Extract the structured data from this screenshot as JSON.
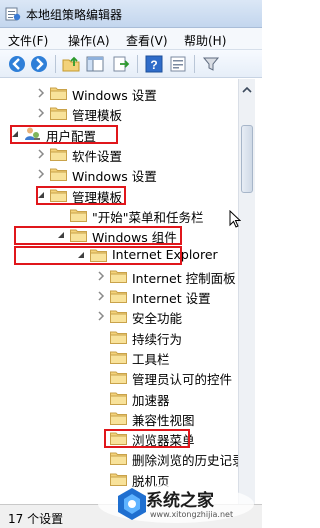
{
  "window": {
    "title": "本地组策略编辑器"
  },
  "menu": [
    "文件(F)",
    "操作(A)",
    "查看(V)",
    "帮助(H)"
  ],
  "toolbar": {
    "buttons": [
      "back-icon",
      "forward-icon",
      "up-folder-icon",
      "show-hide-tree-icon",
      "export-list-icon",
      "help-icon",
      "properties-icon",
      "filter-icon"
    ]
  },
  "tree": {
    "rows": [
      {
        "label": "Windows 设置",
        "expander": "collapsed",
        "icon": "folder-icon"
      },
      {
        "label": "管理模板",
        "expander": "collapsed",
        "icon": "folder-icon"
      },
      {
        "label": "用户配置",
        "expander": "expanded",
        "icon": "user-config-icon",
        "highlighted": true
      },
      {
        "label": "软件设置",
        "expander": "collapsed",
        "icon": "folder-icon"
      },
      {
        "label": "Windows 设置",
        "expander": "collapsed",
        "icon": "folder-icon"
      },
      {
        "label": "管理模板",
        "expander": "expanded",
        "icon": "folder-icon",
        "highlighted": true
      },
      {
        "label": "\"开始\"菜单和任务栏",
        "expander": "none",
        "icon": "folder-icon"
      },
      {
        "label": "Windows 组件",
        "expander": "expanded",
        "icon": "folder-icon",
        "highlighted": true
      },
      {
        "label": "Internet Explorer",
        "expander": "expanded",
        "icon": "folder-icon",
        "highlighted": true
      },
      {
        "label": "Internet 控制面板",
        "expander": "collapsed",
        "icon": "folder-icon"
      },
      {
        "label": "Internet 设置",
        "expander": "collapsed",
        "icon": "folder-icon"
      },
      {
        "label": "安全功能",
        "expander": "collapsed",
        "icon": "folder-icon"
      },
      {
        "label": "持续行为",
        "expander": "none",
        "icon": "folder-icon"
      },
      {
        "label": "工具栏",
        "expander": "none",
        "icon": "folder-icon"
      },
      {
        "label": "管理员认可的控件",
        "expander": "none",
        "icon": "folder-icon"
      },
      {
        "label": "加速器",
        "expander": "none",
        "icon": "folder-icon"
      },
      {
        "label": "兼容性视图",
        "expander": "none",
        "icon": "folder-icon"
      },
      {
        "label": "浏览器菜单",
        "expander": "none",
        "icon": "folder-icon",
        "highlighted": true
      },
      {
        "label": "删除浏览的历史记录",
        "expander": "none",
        "icon": "folder-icon"
      },
      {
        "label": "脱机页",
        "expander": "none",
        "icon": "folder-icon"
      }
    ]
  },
  "status": {
    "text": "17 个设置"
  },
  "watermark": {
    "text": "系统之家",
    "url": "www.xitongzhijia.net"
  },
  "colors": {
    "highlight": "#e0161b",
    "folder": "#f3d27a",
    "accent": "#1f6fd0"
  }
}
